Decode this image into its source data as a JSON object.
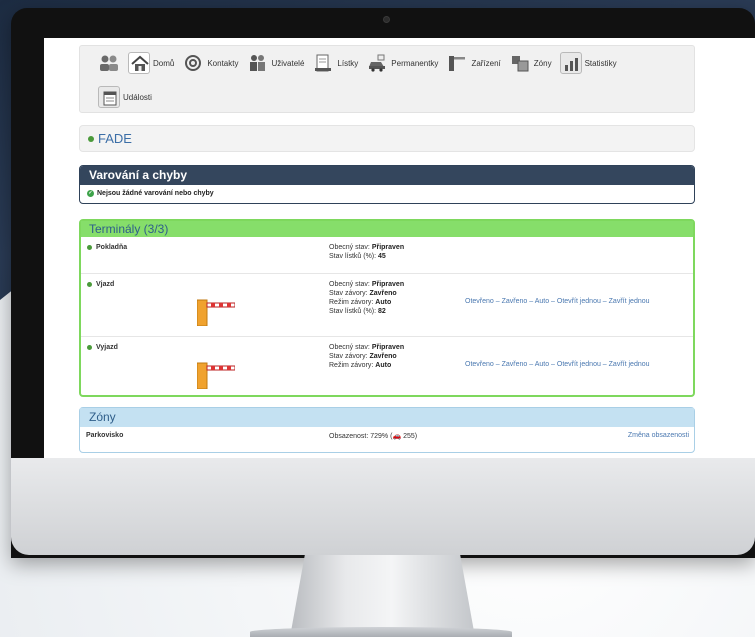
{
  "nav": {
    "items": [
      {
        "label": "",
        "icon": "people-icon"
      },
      {
        "label": "Domů",
        "icon": "home-icon"
      },
      {
        "label": "Kontakty",
        "icon": "at-icon"
      },
      {
        "label": "Uživatelé",
        "icon": "users-icon"
      },
      {
        "label": "Lístky",
        "icon": "ticket-icon"
      },
      {
        "label": "Permanentky",
        "icon": "car-icon"
      },
      {
        "label": "Zařízení",
        "icon": "barrier-icon"
      },
      {
        "label": "Zóny",
        "icon": "zone-icon"
      },
      {
        "label": "Statistiky",
        "icon": "stats-icon"
      },
      {
        "label": "Události",
        "icon": "events-icon"
      }
    ]
  },
  "site": {
    "name": "FADE"
  },
  "warnings": {
    "title": "Varování a chyby",
    "message": "Nejsou žádné varování nebo chyby"
  },
  "terminals": {
    "title": "Terminály (3/3)",
    "rows": [
      {
        "name": "Pokladňa",
        "lines": [
          {
            "label": "Obecný stav:",
            "value": "Připraven"
          },
          {
            "label": "Stav lístků (%):",
            "value": "45"
          }
        ]
      },
      {
        "name": "Vjazd",
        "lines": [
          {
            "label": "Obecný stav:",
            "value": "Připraven"
          },
          {
            "label": "Stav závory:",
            "value": "Zavřeno"
          },
          {
            "label": "Režim závory:",
            "value": "Auto"
          },
          {
            "label": "Stav lístků (%):",
            "value": "82"
          }
        ],
        "actions": [
          "Otevřeno",
          "Zavřeno",
          "Auto",
          "Otevřít jednou",
          "Zavřít jednou"
        ]
      },
      {
        "name": "Vyjazd",
        "lines": [
          {
            "label": "Obecný stav:",
            "value": "Připraven"
          },
          {
            "label": "Stav závory:",
            "value": "Zavřeno"
          },
          {
            "label": "Režim závory:",
            "value": "Auto"
          }
        ],
        "actions": [
          "Otevřeno",
          "Zavřeno",
          "Auto",
          "Otevřít jednou",
          "Zavřít jednou"
        ]
      }
    ]
  },
  "zones": {
    "title": "Zóny",
    "rows": [
      {
        "name": "Parkovisko",
        "occupancy_prefix": "Obsazenost: 729% (",
        "occupancy_count": "255",
        "occupancy_suffix": ")",
        "action": "Změna obsazenosti"
      }
    ]
  },
  "colors": {
    "terminals_accent": "#86de6a",
    "warnings_accent": "#34465d",
    "zones_accent": "#c4e1f2",
    "link": "#4a78b0"
  }
}
